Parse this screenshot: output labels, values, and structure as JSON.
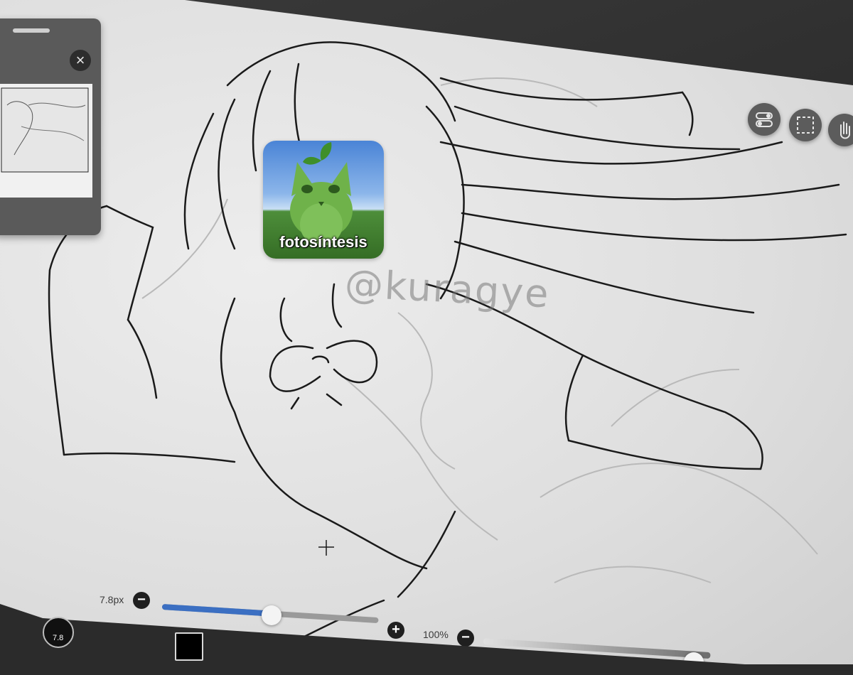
{
  "app": {
    "canvas_content": "line art drawing",
    "watermark": "@kuragye"
  },
  "navigator": {
    "close_icon": "close-icon",
    "close_glyph": "×"
  },
  "tools": {
    "toggle_icon": "toggle-icon",
    "selection_icon": "selection-icon",
    "hand_icon": "hand-icon"
  },
  "sticker": {
    "label": "fotosíntesis",
    "image": "green-cat-sticker"
  },
  "bottom_bar": {
    "brush_size_label": "7.8px",
    "brush_size_value": 7.8,
    "brush_indicator_text": "7.8",
    "minus_glyph": "−",
    "plus_glyph": "+",
    "brush_slider_fraction": 0.5,
    "opacity_label": "100%",
    "opacity_value": 100,
    "current_color": "#000000",
    "accent": "#3b6fc2"
  }
}
